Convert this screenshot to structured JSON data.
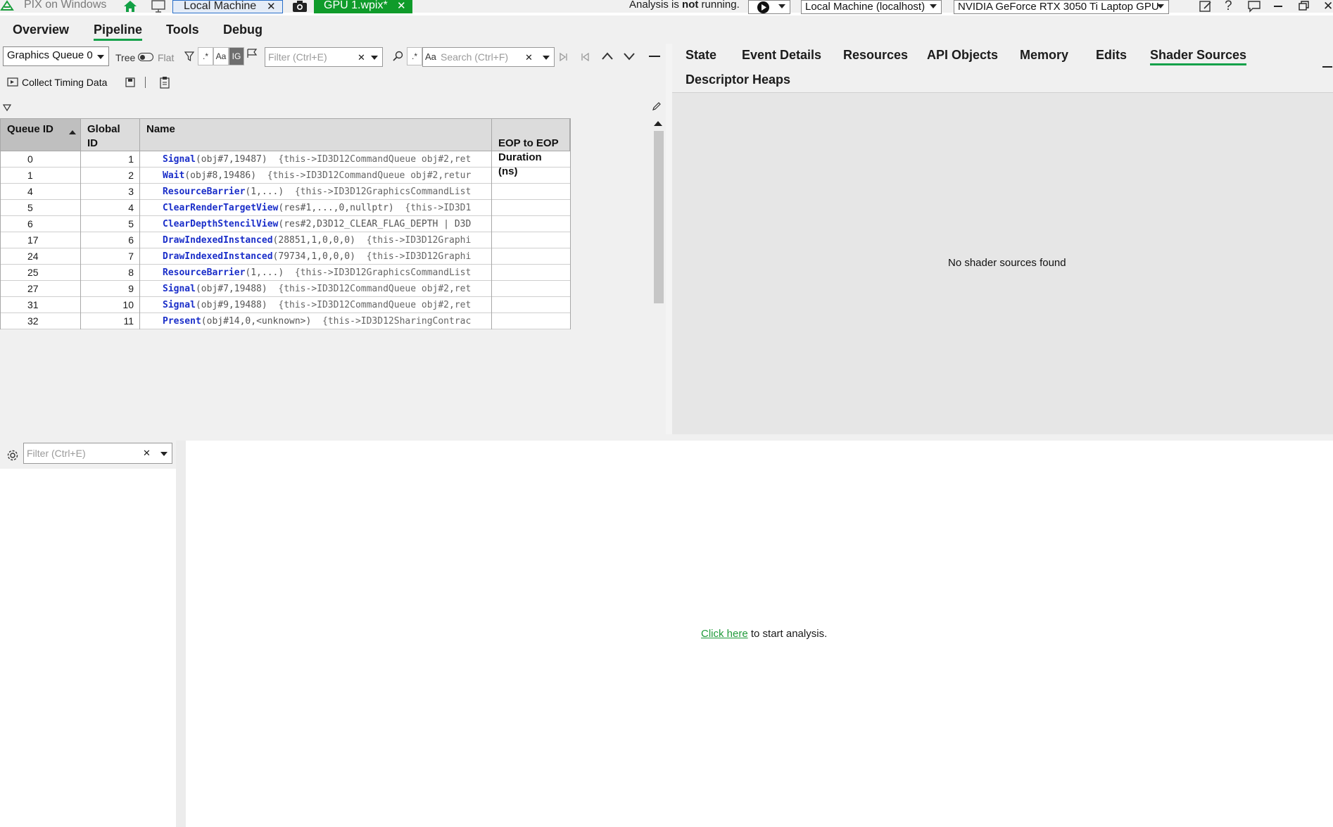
{
  "titlebar": {
    "app_title": "PIX on Windows",
    "tab_local": "Local Machine",
    "tab_gpu": "GPU 1.wpix*",
    "analysis_prefix": "Analysis is ",
    "analysis_bold": "not",
    "analysis_suffix": " running.",
    "machine_select": "Local Machine (localhost)",
    "gpu_select": "NVIDIA GeForce RTX 3050 Ti Laptop GPU"
  },
  "nav": {
    "items": [
      "Overview",
      "Pipeline",
      "Tools",
      "Debug"
    ],
    "active": "Pipeline"
  },
  "events_toolbar": {
    "queue_select": "Graphics Queue 0",
    "tree_label": "Tree",
    "flat_label": "Flat",
    "regex_label": ".*",
    "case_label": "Aa",
    "ig_label": "IG",
    "filter_placeholder": "Filter (Ctrl+E)",
    "search_placeholder": "Search (Ctrl+F)",
    "collect_timing": "Collect Timing Data"
  },
  "grid": {
    "headers": [
      "Queue ID",
      "Global ID",
      "Name",
      "EOP to EOP\nDuration (ns)"
    ],
    "rows": [
      {
        "queue": "0",
        "global": "1",
        "fn": "Signal",
        "args": "(obj#7,19487)",
        "detail": "  {this->ID3D12CommandQueue obj#2,ret"
      },
      {
        "queue": "1",
        "global": "2",
        "fn": "Wait",
        "args": "(obj#8,19486)",
        "detail": "  {this->ID3D12CommandQueue obj#2,retur"
      },
      {
        "queue": "4",
        "global": "3",
        "fn": "ResourceBarrier",
        "args": "(1,...)",
        "detail": "  {this->ID3D12GraphicsCommandList"
      },
      {
        "queue": "5",
        "global": "4",
        "fn": "ClearRenderTargetView",
        "args": "(res#1,...,0,nullptr)",
        "detail": "  {this->ID3D1"
      },
      {
        "queue": "6",
        "global": "5",
        "fn": "ClearDepthStencilView",
        "args": "(res#2,D3D12_CLEAR_FLAG_DEPTH | D3D",
        "detail": ""
      },
      {
        "queue": "17",
        "global": "6",
        "fn": "DrawIndexedInstanced",
        "args": "(28851,1,0,0,0)",
        "detail": "  {this->ID3D12Graphi"
      },
      {
        "queue": "24",
        "global": "7",
        "fn": "DrawIndexedInstanced",
        "args": "(79734,1,0,0,0)",
        "detail": "  {this->ID3D12Graphi"
      },
      {
        "queue": "25",
        "global": "8",
        "fn": "ResourceBarrier",
        "args": "(1,...)",
        "detail": "  {this->ID3D12GraphicsCommandList"
      },
      {
        "queue": "27",
        "global": "9",
        "fn": "Signal",
        "args": "(obj#7,19488)",
        "detail": "  {this->ID3D12CommandQueue obj#2,ret"
      },
      {
        "queue": "31",
        "global": "10",
        "fn": "Signal",
        "args": "(obj#9,19488)",
        "detail": "  {this->ID3D12CommandQueue obj#2,ret"
      },
      {
        "queue": "32",
        "global": "11",
        "fn": "Present",
        "args": "(obj#14,0,<unknown>)",
        "detail": "  {this->ID3D12SharingContrac"
      }
    ]
  },
  "right_tabs": {
    "row1": [
      "State",
      "Event Details",
      "Resources",
      "API Objects",
      "Memory",
      "Edits",
      "Shader Sources"
    ],
    "row2": [
      "Descriptor Heaps"
    ],
    "active": "Shader Sources"
  },
  "shader_panel": {
    "empty_message": "No shader sources found"
  },
  "bottom": {
    "filter_placeholder": "Filter (Ctrl+E)",
    "link_text": "Click here",
    "after_link": " to start analysis."
  },
  "colors": {
    "accent_green": "#14a14a",
    "gpu_tab": "#0f9b2a",
    "function_blue": "#1a2ec9",
    "link_green": "#1f9a3a"
  }
}
